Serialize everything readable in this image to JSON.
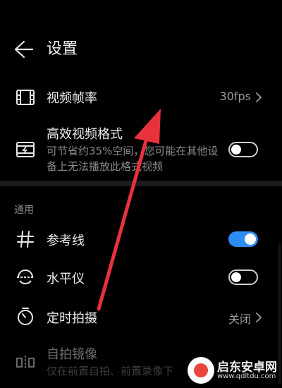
{
  "header": {
    "title": "设置",
    "back_icon": "arrow-left-icon"
  },
  "rows": {
    "frame_rate": {
      "label": "视频帧率",
      "value": "30fps",
      "icon": "film-icon"
    },
    "efficient_format": {
      "label": "高效视频格式",
      "description": "可节省约35%空间，您可能在其他设备上无法播放此格式视频",
      "icon": "video-format-icon",
      "enabled": false
    }
  },
  "section": {
    "general_label": "通用"
  },
  "general": {
    "grid": {
      "label": "参考线",
      "icon": "grid-icon",
      "enabled": true
    },
    "level": {
      "label": "水平仪",
      "icon": "level-icon",
      "enabled": false
    },
    "timer": {
      "label": "定时拍摄",
      "value": "关闭",
      "icon": "timer-icon"
    },
    "selfie_mirror": {
      "label": "自拍镜像",
      "description": "仅在前置自拍、前置录像下",
      "icon": "mirror-icon"
    }
  },
  "watermark": {
    "text": "启东安卓网",
    "url": "www.qdltdu.com"
  },
  "colors": {
    "accent": "#2c8cf4",
    "annotation_arrow": "#e8323c",
    "background": "#000000"
  }
}
